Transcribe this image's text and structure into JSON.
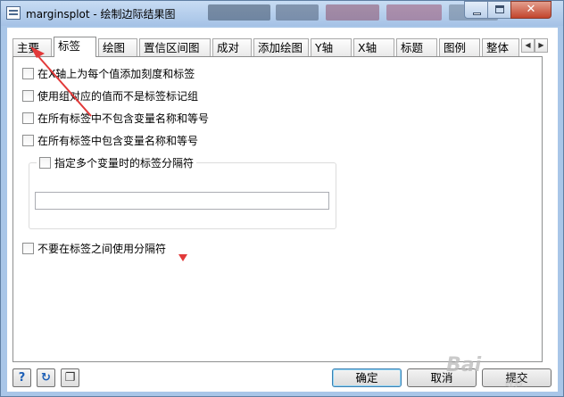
{
  "window": {
    "title": "marginsplot - 绘制边际结果图"
  },
  "tabs": [
    {
      "label": "主要"
    },
    {
      "label": "标签"
    },
    {
      "label": "绘图"
    },
    {
      "label": "置信区间图"
    },
    {
      "label": "成对"
    },
    {
      "label": "添加绘图"
    },
    {
      "label": "Y轴"
    },
    {
      "label": "X轴"
    },
    {
      "label": "标题"
    },
    {
      "label": "图例"
    },
    {
      "label": "整体"
    }
  ],
  "active_tab": "标签",
  "options": [
    {
      "label": "在X轴上为每个值添加刻度和标签",
      "checked": false
    },
    {
      "label": "使用组对应的值而不是标签标记组",
      "checked": false
    },
    {
      "label": "在所有标签中不包含变量名称和等号",
      "checked": false
    },
    {
      "label": "在所有标签中包含变量名称和等号",
      "checked": false
    }
  ],
  "separator_group": {
    "label": "指定多个变量时的标签分隔符",
    "checked": false,
    "input_value": ""
  },
  "no_separator_option": {
    "label": "不要在标签之间使用分隔符",
    "checked": false
  },
  "buttons": {
    "help_icon": "?",
    "ok": "确定",
    "cancel": "取消",
    "submit": "提交"
  },
  "watermark": {
    "main": "Bai",
    "sub": "经验"
  },
  "colors": {
    "accent_red": "#e23a3a",
    "frame_blue": "#a9c6e8"
  }
}
